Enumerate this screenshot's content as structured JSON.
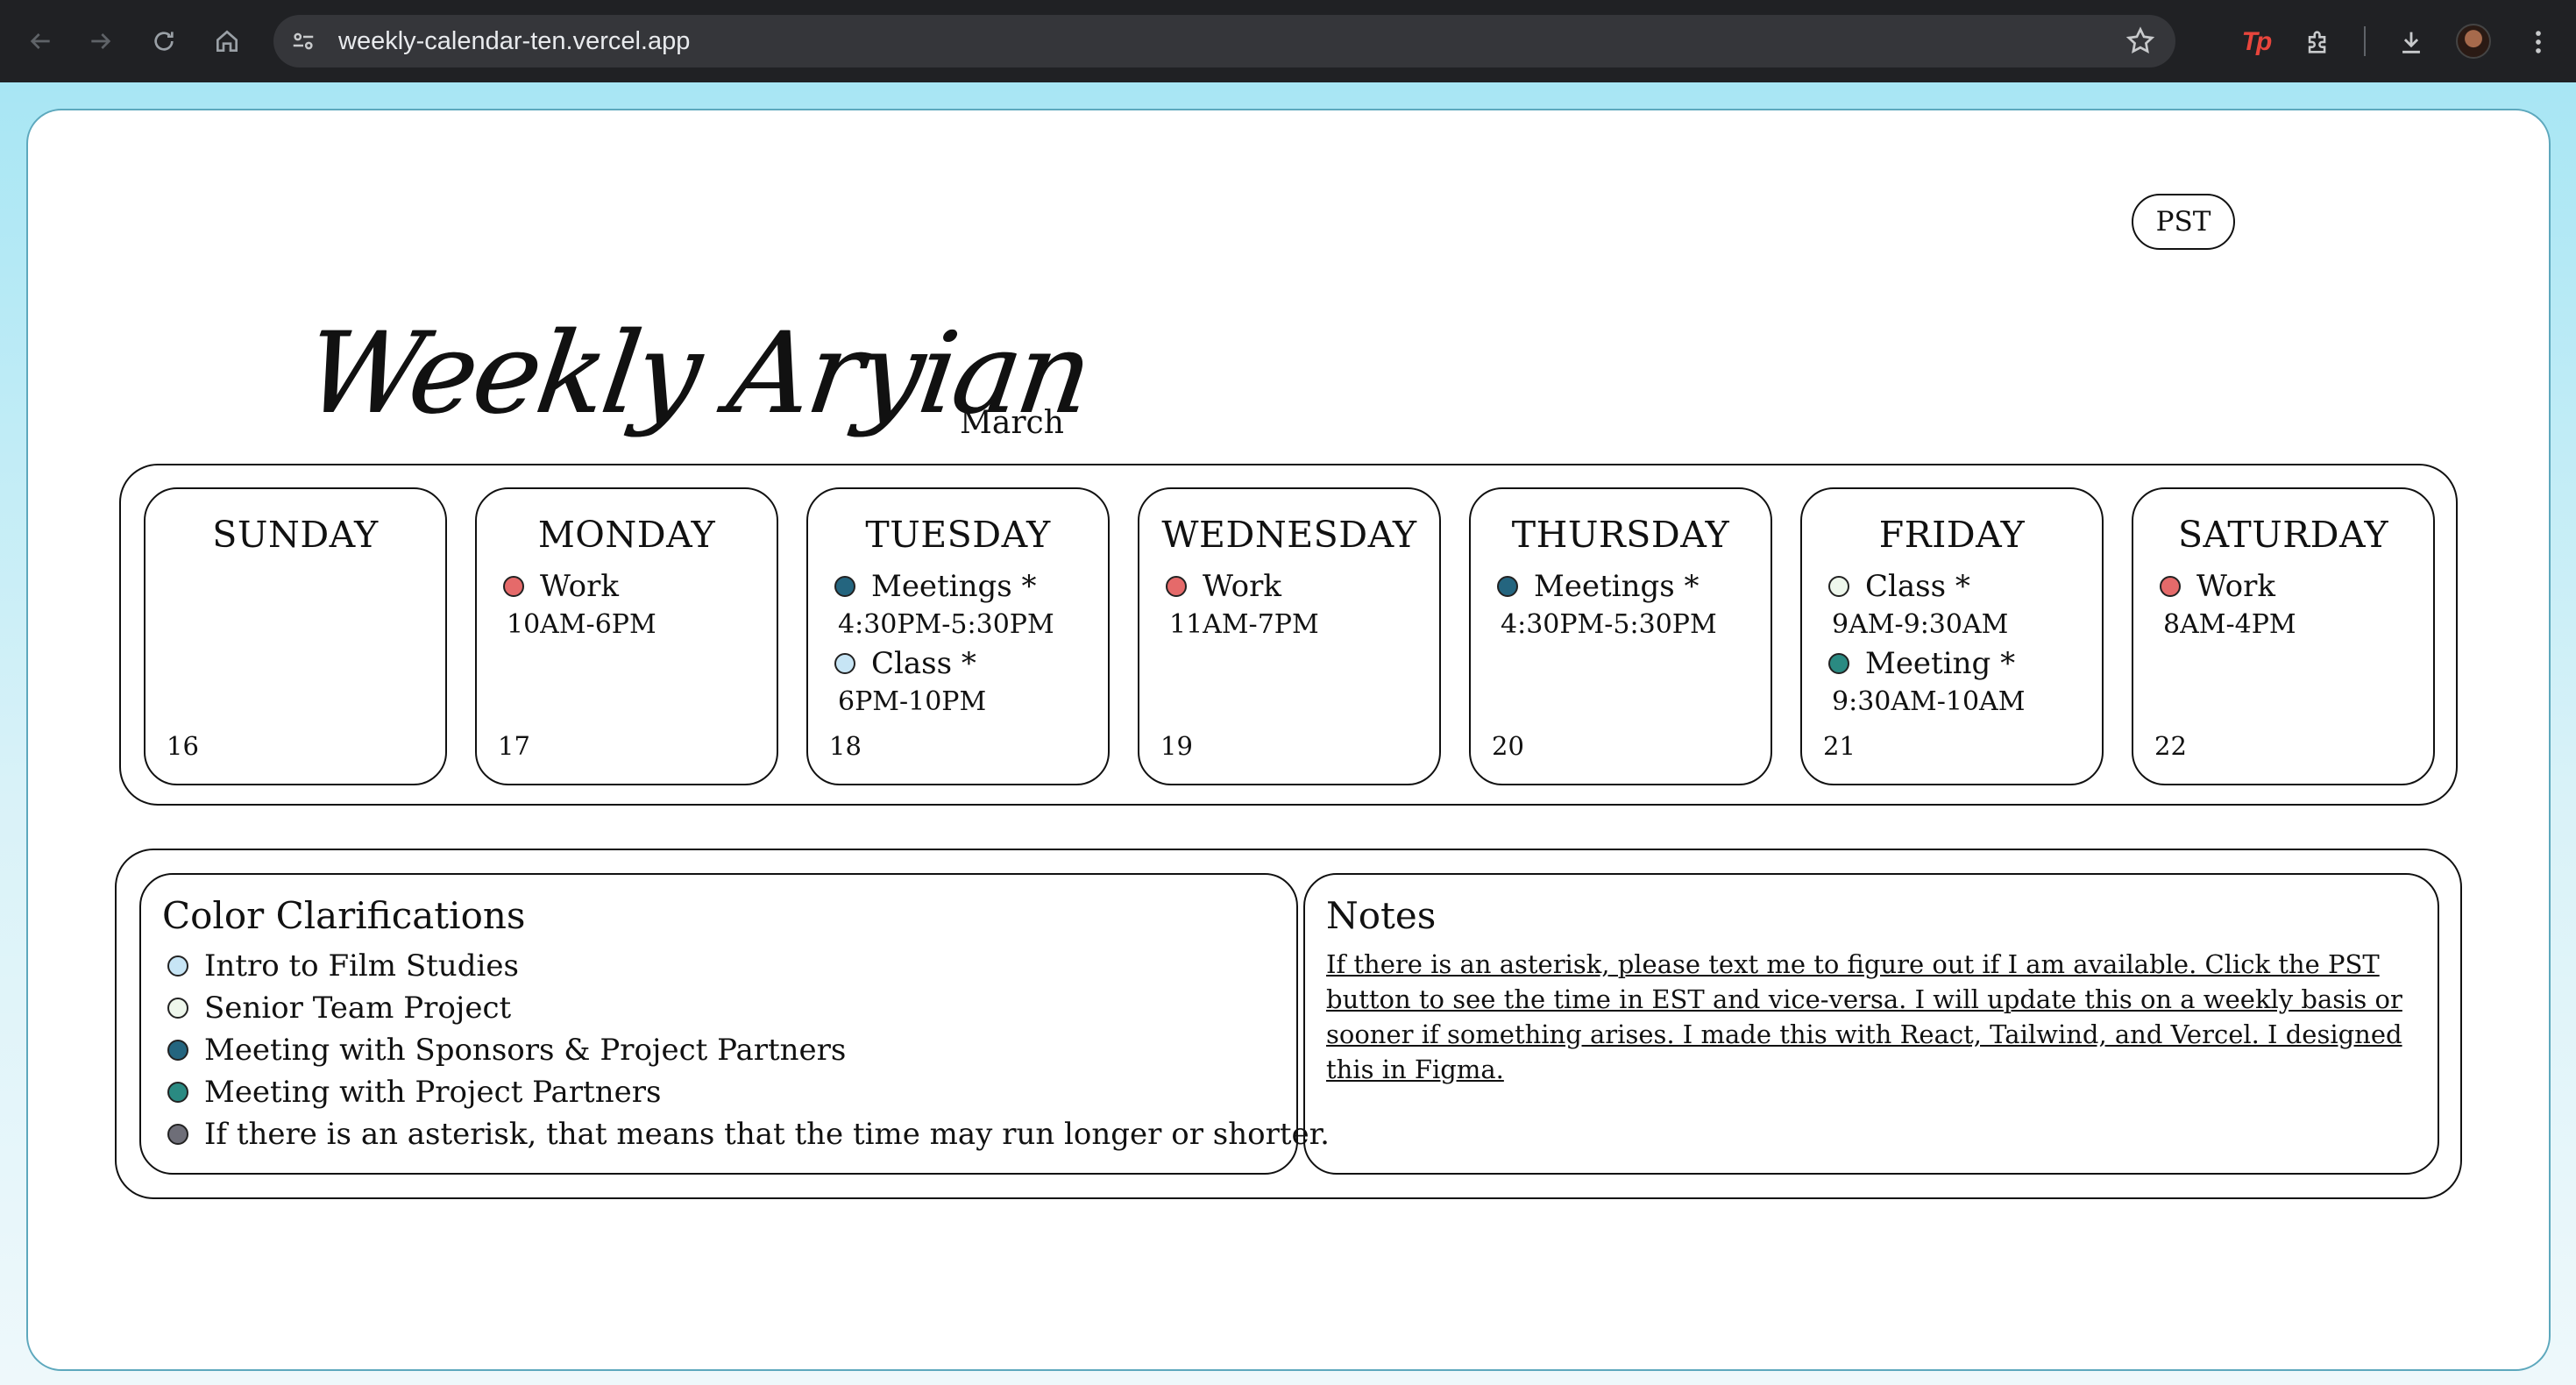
{
  "browser": {
    "url": "weekly-calendar-ten.vercel.app",
    "extension_label": "Tp",
    "icons": [
      "back-arrow-icon",
      "forward-arrow-icon",
      "reload-icon",
      "home-icon",
      "site-settings-icon",
      "star-icon",
      "extensions-puzzle-icon",
      "download-icon",
      "more-vertical-icon"
    ]
  },
  "header": {
    "timezone_button": "PST",
    "title": "Weekly Aryian",
    "month": "March"
  },
  "colors": {
    "work": "#e56a6a",
    "meeting_sponsors": "#24657f",
    "meeting_partners": "#2a8a82",
    "film": "#c7e5f5",
    "senior_project": "#eef7ec",
    "asterisk": "#6e6e78"
  },
  "days": [
    {
      "name": "SUNDAY",
      "date": "16",
      "events": []
    },
    {
      "name": "MONDAY",
      "date": "17",
      "events": [
        {
          "label": "Work",
          "time": "10AM-6PM",
          "color": "#e56a6a"
        }
      ]
    },
    {
      "name": "TUESDAY",
      "date": "18",
      "events": [
        {
          "label": "Meetings *",
          "time": "4:30PM-5:30PM",
          "color": "#24657f"
        },
        {
          "label": "Class *",
          "time": "6PM-10PM",
          "color": "#c7e5f5"
        }
      ]
    },
    {
      "name": "WEDNESDAY",
      "date": "19",
      "events": [
        {
          "label": "Work",
          "time": "11AM-7PM",
          "color": "#e56a6a"
        }
      ]
    },
    {
      "name": "THURSDAY",
      "date": "20",
      "events": [
        {
          "label": "Meetings *",
          "time": "4:30PM-5:30PM",
          "color": "#24657f"
        }
      ]
    },
    {
      "name": "FRIDAY",
      "date": "21",
      "events": [
        {
          "label": "Class *",
          "time": "9AM-9:30AM",
          "color": "#eef7ec"
        },
        {
          "label": "Meeting *",
          "time": "9:30AM-10AM",
          "color": "#2a8a82"
        }
      ]
    },
    {
      "name": "SATURDAY",
      "date": "22",
      "events": [
        {
          "label": "Work",
          "time": "8AM-4PM",
          "color": "#e56a6a"
        }
      ]
    }
  ],
  "legend": {
    "title": "Color Clarifications",
    "items": [
      {
        "text": "Intro to Film Studies",
        "color": "#c7e5f5"
      },
      {
        "text": "Senior Team Project",
        "color": "#eef7ec"
      },
      {
        "text": "Meeting with Sponsors & Project Partners",
        "color": "#24657f"
      },
      {
        "text": "Meeting with Project Partners",
        "color": "#2a8a82"
      },
      {
        "text": "If there is an asterisk, that means that the time may run longer or shorter.",
        "color": "#6e6e78"
      }
    ]
  },
  "notes": {
    "title": "Notes",
    "body": "If there is an asterisk, please text me to figure out if I am available. Click the PST button to see the time in EST and vice-versa. I will update this on a weekly basis or sooner if something arises. I made this with React, Tailwind, and Vercel. I designed this in Figma."
  }
}
